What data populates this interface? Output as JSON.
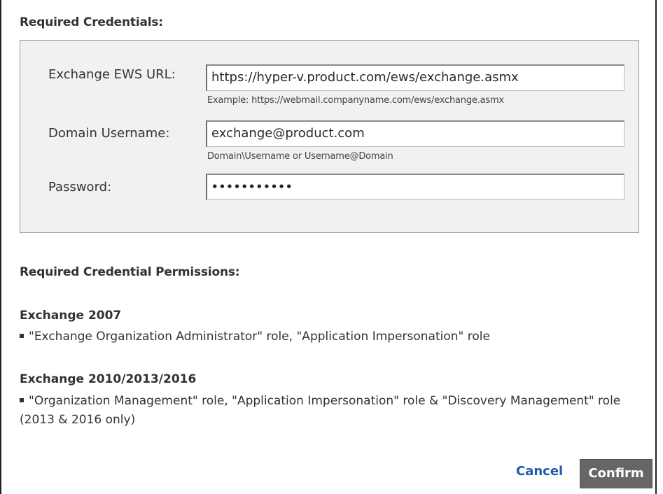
{
  "credentials": {
    "section_title": "Required Credentials:",
    "ews_url": {
      "label": "Exchange EWS URL:",
      "value": "https://hyper-v.product.com/ews/exchange.asmx",
      "hint": "Example: https://webmail.companyname.com/ews/exchange.asmx"
    },
    "username": {
      "label": "Domain Username:",
      "value": "exchange@product.com",
      "hint": "Domain\\Username or Username@Domain"
    },
    "password": {
      "label": "Password:",
      "masked_value": "•••••••••••"
    }
  },
  "permissions": {
    "section_title": "Required Credential Permissions:",
    "exchange_2007": {
      "title": "Exchange 2007",
      "text": "\"Exchange Organization Administrator\" role, \"Application Impersonation\" role"
    },
    "exchange_2010": {
      "title": "Exchange 2010/2013/2016",
      "text": "\"Organization Management\" role, \"Application Impersonation\" role & \"Discovery Management\" role (2013 & 2016 only)"
    }
  },
  "actions": {
    "cancel_label": "Cancel",
    "confirm_label": "Confirm"
  },
  "colors": {
    "link": "#1f5aa6",
    "confirm_button_bg": "#666666",
    "credentials_box_bg": "#f1f1f1"
  }
}
